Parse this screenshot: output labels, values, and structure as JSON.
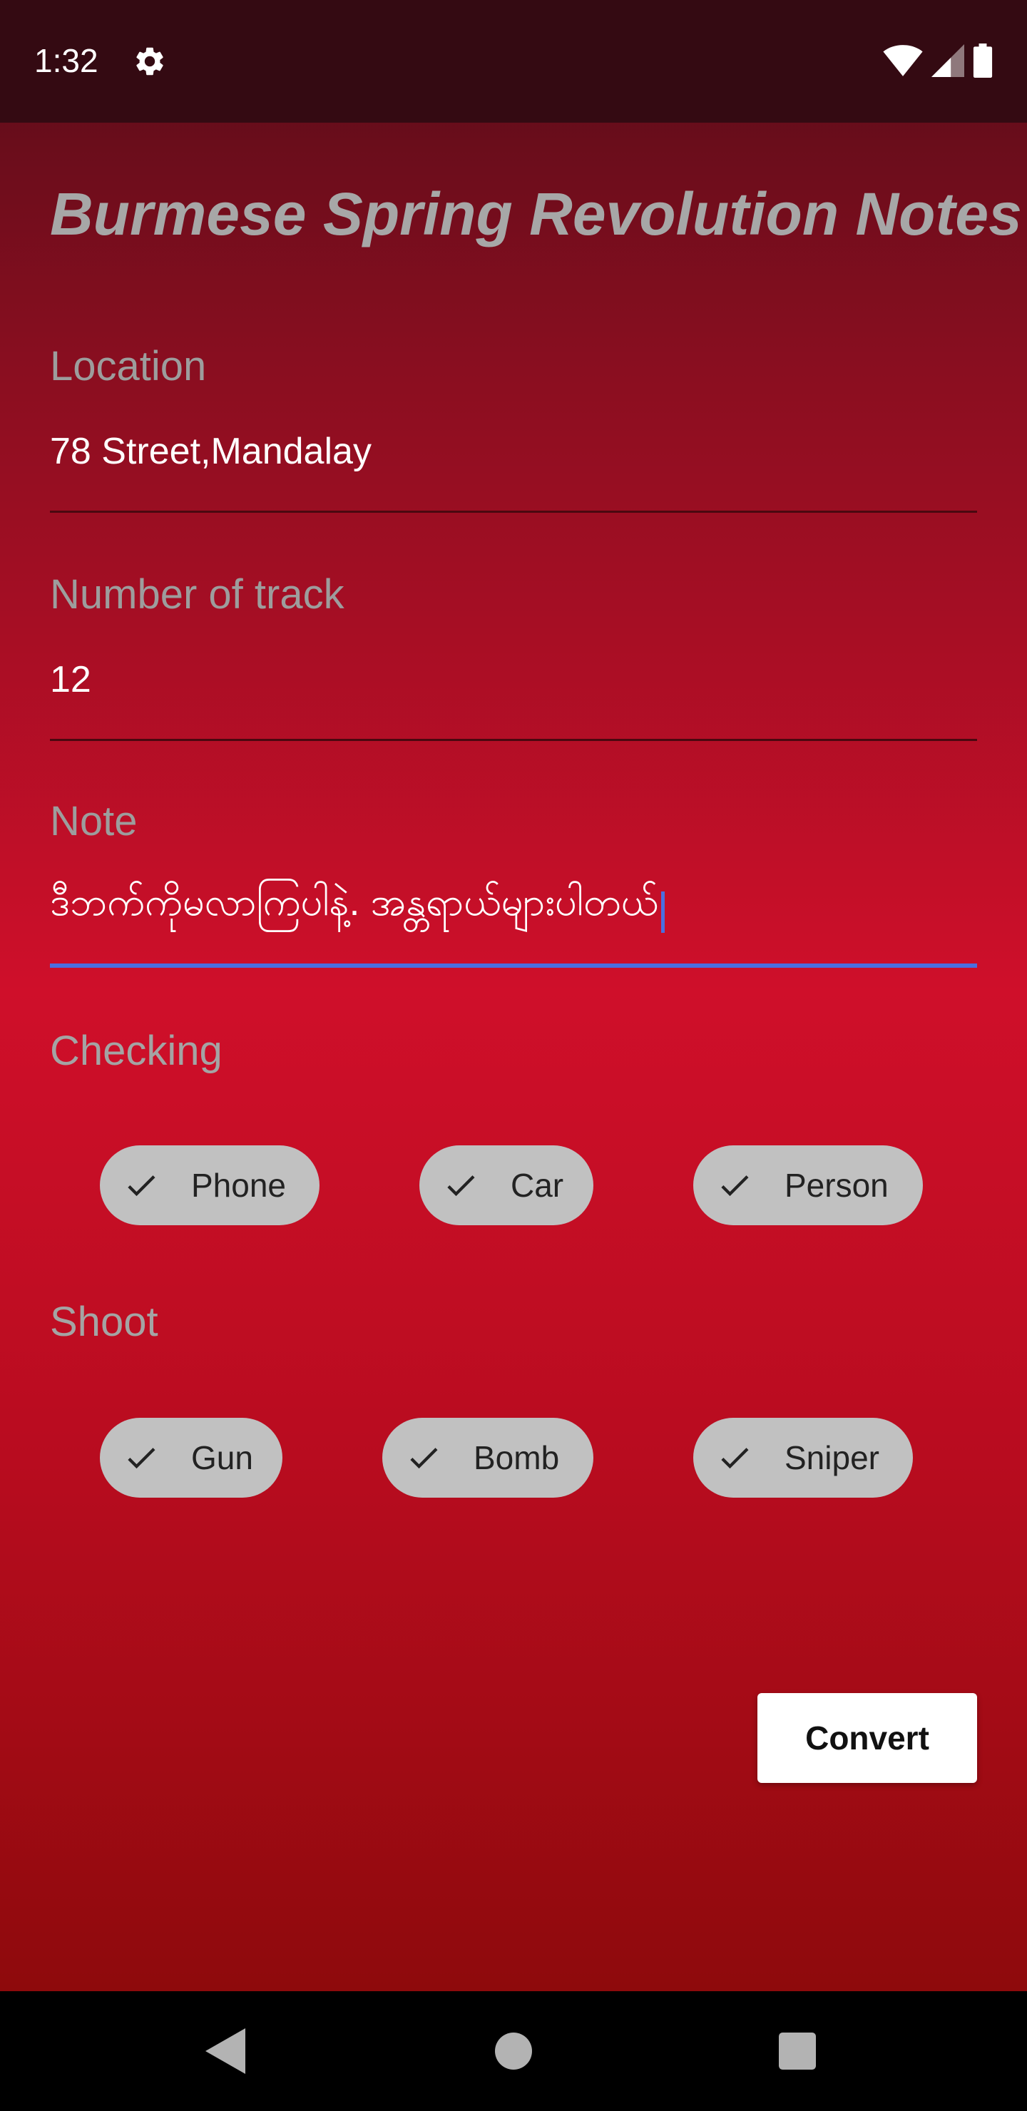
{
  "status_bar": {
    "time": "1:32",
    "icons": [
      "gear-icon",
      "wifi-icon",
      "signal-icon",
      "battery-icon"
    ]
  },
  "app": {
    "title": "Burmese Spring Revolution Notes"
  },
  "form": {
    "location": {
      "label": "Location",
      "value": "78 Street,Mandalay"
    },
    "track": {
      "label": "Number of track",
      "value": "12"
    },
    "note": {
      "label": "Note",
      "value": "ဒီဘက်ကိုမလာကြပါနဲ့. အန္တရာယ်များပါတယ်"
    }
  },
  "checking": {
    "label": "Checking",
    "chips": [
      {
        "label": "Phone",
        "checked": true
      },
      {
        "label": "Car",
        "checked": true
      },
      {
        "label": "Person",
        "checked": true
      }
    ]
  },
  "shoot": {
    "label": "Shoot",
    "chips": [
      {
        "label": "Gun",
        "checked": true
      },
      {
        "label": "Bomb",
        "checked": true
      },
      {
        "label": "Sniper",
        "checked": true
      }
    ]
  },
  "actions": {
    "convert_label": "Convert"
  },
  "nav": {
    "icons": [
      "back-icon",
      "home-icon",
      "recents-icon"
    ]
  },
  "colors": {
    "accent": "#4a6fe0",
    "chip_bg": "#c1c1c1",
    "status_bar": "#340a12",
    "gradient_top": "#560c18",
    "gradient_mid": "#cf0f2a",
    "gradient_bottom": "#8e0a0c"
  }
}
